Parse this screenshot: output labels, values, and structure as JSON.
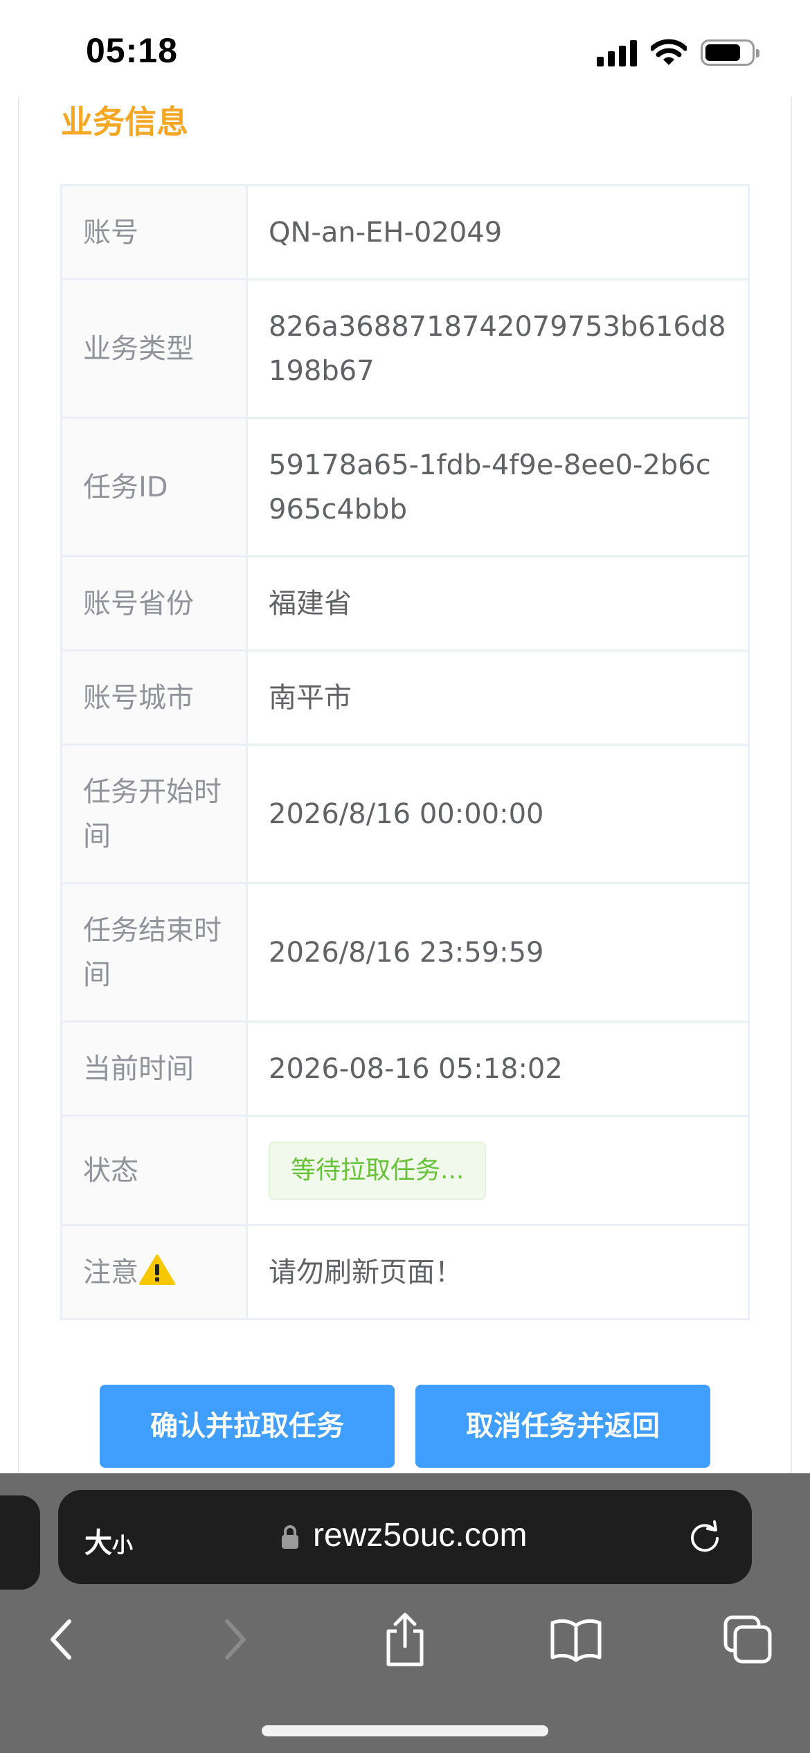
{
  "status_bar": {
    "time": "05:18"
  },
  "section": {
    "title": "业务信息"
  },
  "rows": [
    {
      "label": "账号",
      "value": "QN-an-EH-02049"
    },
    {
      "label": "业务类型",
      "value": "826a3688718742079753b616d8198b67"
    },
    {
      "label": "任务ID",
      "value": "59178a65-1fdb-4f9e-8ee0-2b6c965c4bbb"
    },
    {
      "label": "账号省份",
      "value": "福建省"
    },
    {
      "label": "账号城市",
      "value": "南平市"
    },
    {
      "label": "任务开始时间",
      "value": "2026/8/16 00:00:00"
    },
    {
      "label": "任务结束时间",
      "value": "2026/8/16 23:59:59"
    },
    {
      "label": "当前时间",
      "value": "2026-08-16 05:18:02"
    },
    {
      "label": "状态",
      "value": "等待拉取任务..."
    },
    {
      "label": "注意",
      "value": "请勿刷新页面！"
    }
  ],
  "buttons": {
    "confirm": "确认并拉取任务",
    "cancel": "取消任务并返回"
  },
  "browser": {
    "aa_big": "大",
    "aa_small": "小",
    "url": "rewz5ouc.com"
  },
  "colors": {
    "accent": "#409eff",
    "title": "#f5a623",
    "success": "#67c23a"
  }
}
